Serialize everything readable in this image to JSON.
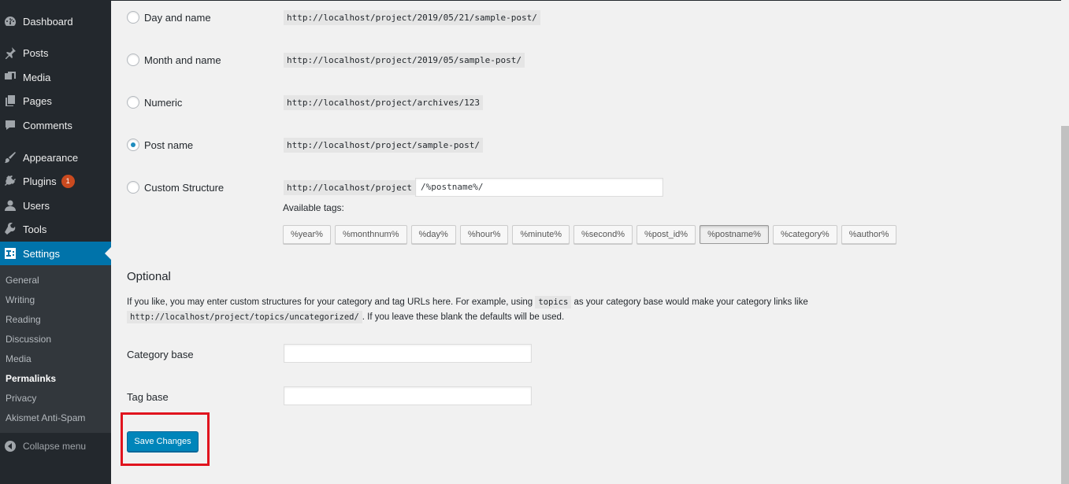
{
  "sidebar": {
    "items": [
      {
        "label": "Dashboard",
        "icon": "dashboard-icon"
      },
      {
        "label": "Posts",
        "icon": "pin-icon"
      },
      {
        "label": "Media",
        "icon": "media-icon"
      },
      {
        "label": "Pages",
        "icon": "pages-icon"
      },
      {
        "label": "Comments",
        "icon": "comment-icon"
      },
      {
        "label": "Appearance",
        "icon": "brush-icon"
      },
      {
        "label": "Plugins",
        "icon": "plug-icon",
        "badge": "1"
      },
      {
        "label": "Users",
        "icon": "user-icon"
      },
      {
        "label": "Tools",
        "icon": "wrench-icon"
      },
      {
        "label": "Settings",
        "icon": "settings-icon"
      }
    ],
    "submenu": [
      "General",
      "Writing",
      "Reading",
      "Discussion",
      "Media",
      "Permalinks",
      "Privacy",
      "Akismet Anti-Spam"
    ],
    "collapse_label": "Collapse menu"
  },
  "permalinks": {
    "options": [
      {
        "label": "Day and name",
        "example": "http://localhost/project/2019/05/21/sample-post/"
      },
      {
        "label": "Month and name",
        "example": "http://localhost/project/2019/05/sample-post/"
      },
      {
        "label": "Numeric",
        "example": "http://localhost/project/archives/123"
      },
      {
        "label": "Post name",
        "example": "http://localhost/project/sample-post/"
      },
      {
        "label": "Custom Structure",
        "example": "http://localhost/project"
      }
    ],
    "selected": "Post name",
    "custom_value": "/%postname%/",
    "available_tags_label": "Available tags:",
    "tags": [
      "%year%",
      "%monthnum%",
      "%day%",
      "%hour%",
      "%minute%",
      "%second%",
      "%post_id%",
      "%postname%",
      "%category%",
      "%author%"
    ],
    "active_tag": "%postname%"
  },
  "optional": {
    "heading": "Optional",
    "desc_part1": "If you like, you may enter custom structures for your category and tag URLs here. For example, using",
    "desc_code1": "topics",
    "desc_part2": "as your category base would make your category links like",
    "desc_code2": "http://localhost/project/topics/uncategorized/",
    "desc_part3": ". If you leave these blank the defaults will be used.",
    "category_base_label": "Category base",
    "category_base_value": "",
    "tag_base_label": "Tag base",
    "tag_base_value": ""
  },
  "save_label": "Save Changes",
  "colors": {
    "accent": "#0073aa",
    "button": "#0085ba",
    "highlight": "#e0141e",
    "sidebar": "#23282d"
  }
}
